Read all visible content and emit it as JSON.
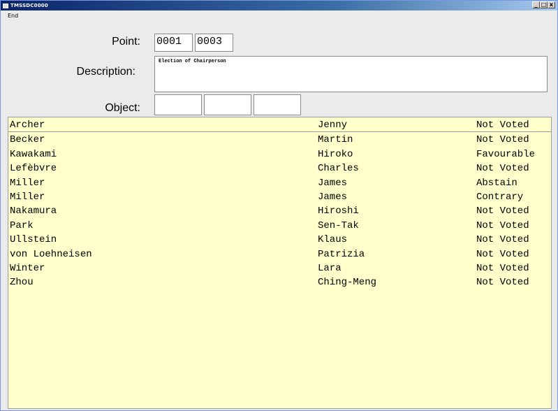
{
  "window": {
    "title": "TMSSDC0000",
    "min_glyph": "_",
    "max_glyph": "□",
    "close_glyph": "x"
  },
  "menu": {
    "items": [
      "End"
    ]
  },
  "form": {
    "point_label": "Point:",
    "point_value_1": "0001",
    "point_value_2": "0003",
    "description_label": "Description:",
    "description_value": "Election of Chairperson",
    "object_label": "Object:",
    "object_values": [
      "",
      "",
      ""
    ]
  },
  "list": {
    "rows": [
      {
        "last": "Archer",
        "first": "Jenny",
        "status": "Not Voted"
      },
      {
        "last": "Becker",
        "first": "Martin",
        "status": "Not Voted"
      },
      {
        "last": "Kawakami",
        "first": "Hiroko",
        "status": "Favourable"
      },
      {
        "last": "Lefèbvre",
        "first": "Charles",
        "status": "Not Voted"
      },
      {
        "last": "Miller",
        "first": "James",
        "status": "Abstain"
      },
      {
        "last": "Miller",
        "first": "James",
        "status": "Contrary"
      },
      {
        "last": "Nakamura",
        "first": "Hiroshi",
        "status": "Not Voted"
      },
      {
        "last": "Park",
        "first": "Sen-Tak",
        "status": "Not Voted"
      },
      {
        "last": "Ullstein",
        "first": "Klaus",
        "status": "Not Voted"
      },
      {
        "last": "von Loehneisen",
        "first": "Patrizia",
        "status": "Not Voted"
      },
      {
        "last": "Winter",
        "first": "Lara",
        "status": "Not Voted"
      },
      {
        "last": "Zhou",
        "first": "Ching-Meng",
        "status": "Not Voted"
      }
    ]
  },
  "colors": {
    "list_background": "#ffffcc",
    "window_background": "#ebebeb",
    "titlebar_start": "#0a246a",
    "titlebar_end": "#a6caf0"
  }
}
